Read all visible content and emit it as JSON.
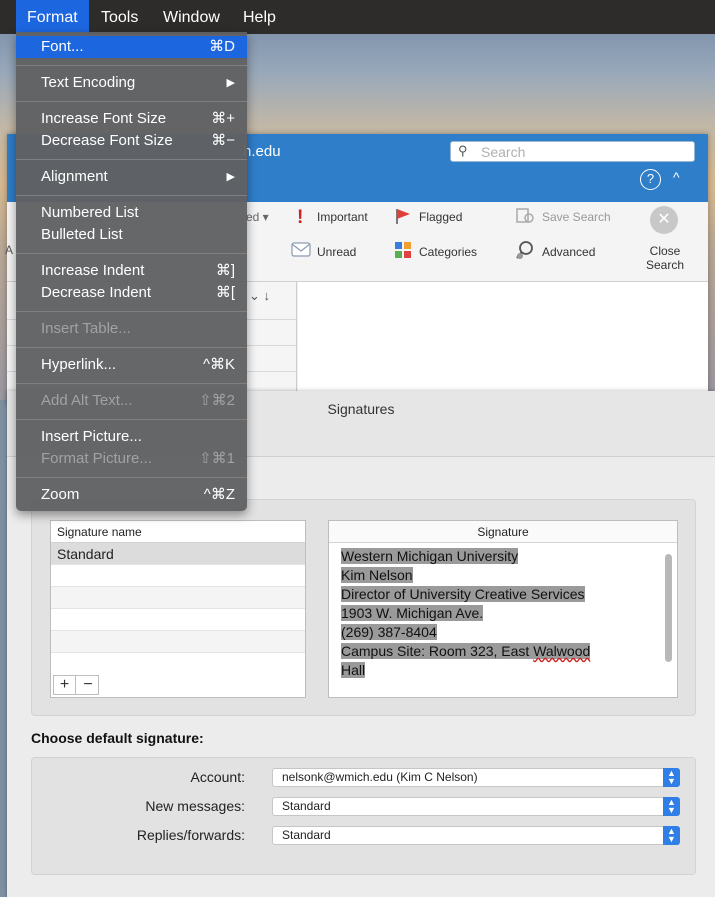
{
  "menubar": {
    "items": [
      "Format",
      "Tools",
      "Window",
      "Help"
    ]
  },
  "format_menu": {
    "groups": [
      [
        {
          "label": "Font...",
          "shortcut": "⌘D"
        }
      ],
      [
        {
          "label": "Text Encoding",
          "shortcut": "▶"
        }
      ],
      [
        {
          "label": "Increase Font Size",
          "shortcut": "⌘+"
        },
        {
          "label": "Decrease Font Size",
          "shortcut": "⌘−"
        }
      ],
      [
        {
          "label": "Alignment",
          "shortcut": "▶"
        }
      ],
      [
        {
          "label": "Numbered List",
          "shortcut": ""
        },
        {
          "label": "Bulleted List",
          "shortcut": ""
        }
      ],
      [
        {
          "label": "Increase Indent",
          "shortcut": "⌘]"
        },
        {
          "label": "Decrease Indent",
          "shortcut": "⌘["
        }
      ],
      [
        {
          "label": "Insert Table...",
          "shortcut": ""
        }
      ],
      [
        {
          "label": "Hyperlink...",
          "shortcut": "^⌘K"
        }
      ],
      [
        {
          "label": "Add Alt Text...",
          "shortcut": "⇧⌘2"
        }
      ],
      [
        {
          "label": "Insert Picture...",
          "shortcut": ""
        },
        {
          "label": "Format Picture...",
          "shortcut": "⇧⌘1"
        }
      ],
      [
        {
          "label": "Zoom",
          "shortcut": "^⌘Z"
        }
      ]
    ]
  },
  "outlook": {
    "title_fragment": "h.edu",
    "search_placeholder": "Search",
    "help_label": "?",
    "collapse_label": "^",
    "ribbon": {
      "edge_letter": "A",
      "flagged_fragment": "ed ▾",
      "important": "Important",
      "flagged": "Flagged",
      "save_search": "Save Search",
      "unread": "Unread",
      "categories": "Categories",
      "advanced": "Advanced",
      "close_search_1": "Close",
      "close_search_2": "Search"
    },
    "sort_controls": "⌄  ↓"
  },
  "signatures": {
    "title": "Signatures",
    "name_header": "Signature name",
    "names": [
      "Standard"
    ],
    "signature_header": "Signature",
    "signature_lines": [
      "Western Michigan University",
      "Kim Nelson",
      "Director of University Creative Services",
      "1903 W. Michigan Ave.",
      "(269) 387-8404",
      "Campus Site: Room 323, East ",
      "Walwood",
      "Hall"
    ],
    "add": "+",
    "remove": "−"
  },
  "defaults": {
    "heading": "Choose default signature:",
    "account_label": "Account:",
    "account_value": "nelsonk@wmich.edu (Kim C Nelson)",
    "new_label": "New messages:",
    "new_value": "Standard",
    "replies_label": "Replies/forwards:",
    "replies_value": "Standard"
  },
  "colors": {
    "accent": "#1c66e0",
    "outlook_blue": "#2f7ec9",
    "menu_bg": "#606163"
  }
}
